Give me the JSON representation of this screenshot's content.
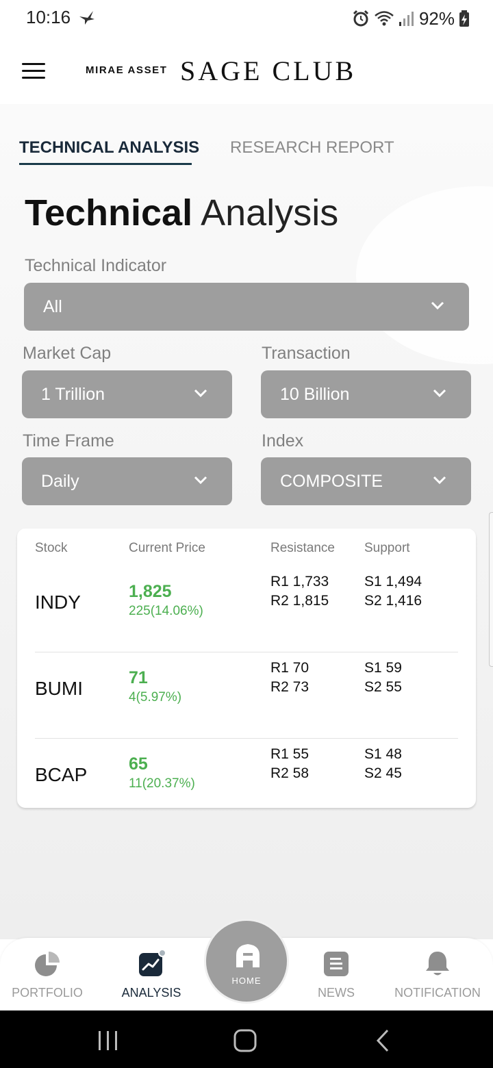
{
  "status_bar": {
    "time": "10:16",
    "battery": "92%"
  },
  "header": {
    "brand_small": "MIRAE ASSET",
    "brand_large": "SAGE CLUB"
  },
  "tabs": [
    {
      "label": "TECHNICAL ANALYSIS",
      "active": true
    },
    {
      "label": "RESEARCH REPORT",
      "active": false
    }
  ],
  "title": {
    "bold": "Technical",
    "light": "Analysis"
  },
  "filters": {
    "technical_indicator": {
      "label": "Technical Indicator",
      "value": "All"
    },
    "market_cap": {
      "label": "Market Cap",
      "value": "1 Trillion"
    },
    "transaction": {
      "label": "Transaction",
      "value": "10 Billion"
    },
    "time_frame": {
      "label": "Time Frame",
      "value": "Daily"
    },
    "index": {
      "label": "Index",
      "value": "COMPOSITE"
    }
  },
  "table": {
    "headers": {
      "stock": "Stock",
      "price": "Current Price",
      "resistance": "Resistance",
      "support": "Support"
    },
    "rows": [
      {
        "ticker": "INDY",
        "price": "1,825",
        "change": "225(14.06%)",
        "r1": "R1 1,733",
        "r2": "R2 1,815",
        "s1": "S1 1,494",
        "s2": "S2 1,416"
      },
      {
        "ticker": "BUMI",
        "price": "71",
        "change": "4(5.97%)",
        "r1": "R1 70",
        "r2": "R2 73",
        "s1": "S1 59",
        "s2": "S2 55"
      },
      {
        "ticker": "BCAP",
        "price": "65",
        "change": "11(20.37%)",
        "r1": "R1 55",
        "r2": "R2 58",
        "s1": "S1 48",
        "s2": "S2 45"
      }
    ]
  },
  "bottom_nav": {
    "portfolio": "PORTFOLIO",
    "analysis": "ANALYSIS",
    "home": "HOME",
    "news": "NEWS",
    "notification": "NOTIFICATION"
  },
  "colors": {
    "positive": "#4caf50",
    "select_bg": "#9e9e9e",
    "accent": "#1a3a4a"
  }
}
